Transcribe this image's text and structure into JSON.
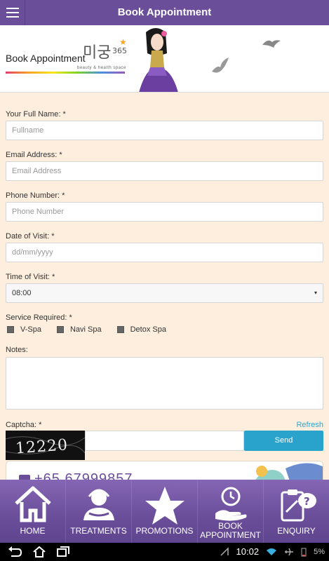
{
  "header": {
    "title": "Book Appointment"
  },
  "banner": {
    "title": "Book Appointment",
    "logo_text": "미궁365",
    "logo_subtitle": "beauty & health space"
  },
  "form": {
    "name_label": "Your Full Name: *",
    "name_placeholder": "Fullname",
    "email_label": "Email Address: *",
    "email_placeholder": "Email Address",
    "phone_label": "Phone Number: *",
    "phone_placeholder": "Phone Number",
    "date_label": "Date of Visit: *",
    "date_placeholder": "dd/mm/yyyy",
    "time_label": "Time of Visit: *",
    "time_value": "08:00",
    "service_label": "Service Required: *",
    "services": [
      "V-Spa",
      "Navi Spa",
      "Detox Spa"
    ],
    "notes_label": "Notes:",
    "captcha_label": "Captcha: *",
    "captcha_text": "12220",
    "refresh_label": "Refresh",
    "send_label": "Send"
  },
  "promo": {
    "phone": "+65 67999857"
  },
  "tabs": [
    {
      "label": "HOME",
      "icon": "home-icon"
    },
    {
      "label": "TREATMENTS",
      "icon": "spa-person-icon"
    },
    {
      "label": "PROMOTIONS",
      "icon": "star-icon"
    },
    {
      "label": "BOOK\nAPPOINTMENT",
      "icon": "clock-hand-icon"
    },
    {
      "label": "ENQUIRY",
      "icon": "clipboard-question-icon"
    }
  ],
  "status": {
    "time": "10:02",
    "battery": "5%"
  },
  "colors": {
    "primary": "#6a4e9a",
    "accent": "#2aa3cc",
    "form_bg": "#fdeedd"
  }
}
